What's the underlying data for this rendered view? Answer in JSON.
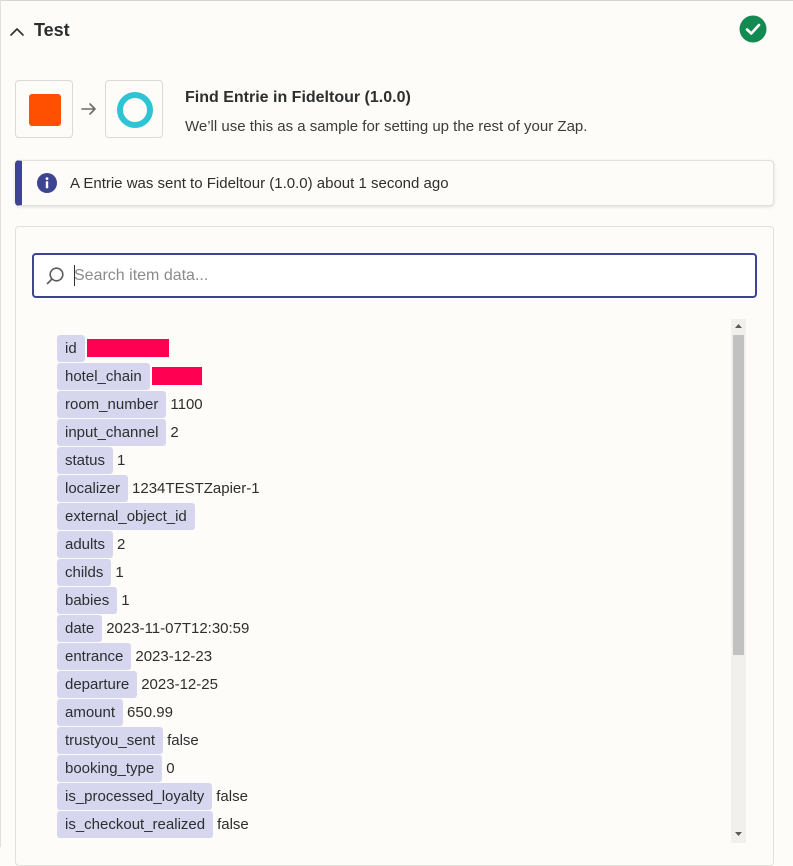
{
  "header": {
    "title": "Test",
    "status": "complete"
  },
  "step": {
    "title": "Find Entrie in Fideltour (1.0.0)",
    "subtitle": "We’ll use this as a sample for setting up the rest of your Zap.",
    "source_icon": "orange-square-icon",
    "target_icon": "fideltour-ring-icon"
  },
  "alert": {
    "text": "A Entrie was sent to Fideltour (1.0.0) about 1 second ago"
  },
  "search": {
    "placeholder": "Search item data...",
    "value": ""
  },
  "items": [
    {
      "key": "id",
      "value": "",
      "redacted": true
    },
    {
      "key": "hotel_chain",
      "value": "",
      "redacted": true
    },
    {
      "key": "room_number",
      "value": "1100"
    },
    {
      "key": "input_channel",
      "value": "2"
    },
    {
      "key": "status",
      "value": "1"
    },
    {
      "key": "localizer",
      "value": "1234TESTZapier-1"
    },
    {
      "key": "external_object_id",
      "value": ""
    },
    {
      "key": "adults",
      "value": "2"
    },
    {
      "key": "childs",
      "value": "1"
    },
    {
      "key": "babies",
      "value": "1"
    },
    {
      "key": "date",
      "value": "2023-11-07T12:30:59"
    },
    {
      "key": "entrance",
      "value": "2023-12-23"
    },
    {
      "key": "departure",
      "value": "2023-12-25"
    },
    {
      "key": "amount",
      "value": "650.99"
    },
    {
      "key": "trustyou_sent",
      "value": "false"
    },
    {
      "key": "booking_type",
      "value": "0"
    },
    {
      "key": "is_processed_loyalty",
      "value": "false"
    },
    {
      "key": "is_checkout_realized",
      "value": "false"
    }
  ],
  "colors": {
    "accent": "#3d4592",
    "success": "#138a52",
    "key_chip": "#d6d7ef",
    "redaction": "#ff0052",
    "source_brand": "#ff4f00",
    "target_brand": "#2ec4d4"
  }
}
